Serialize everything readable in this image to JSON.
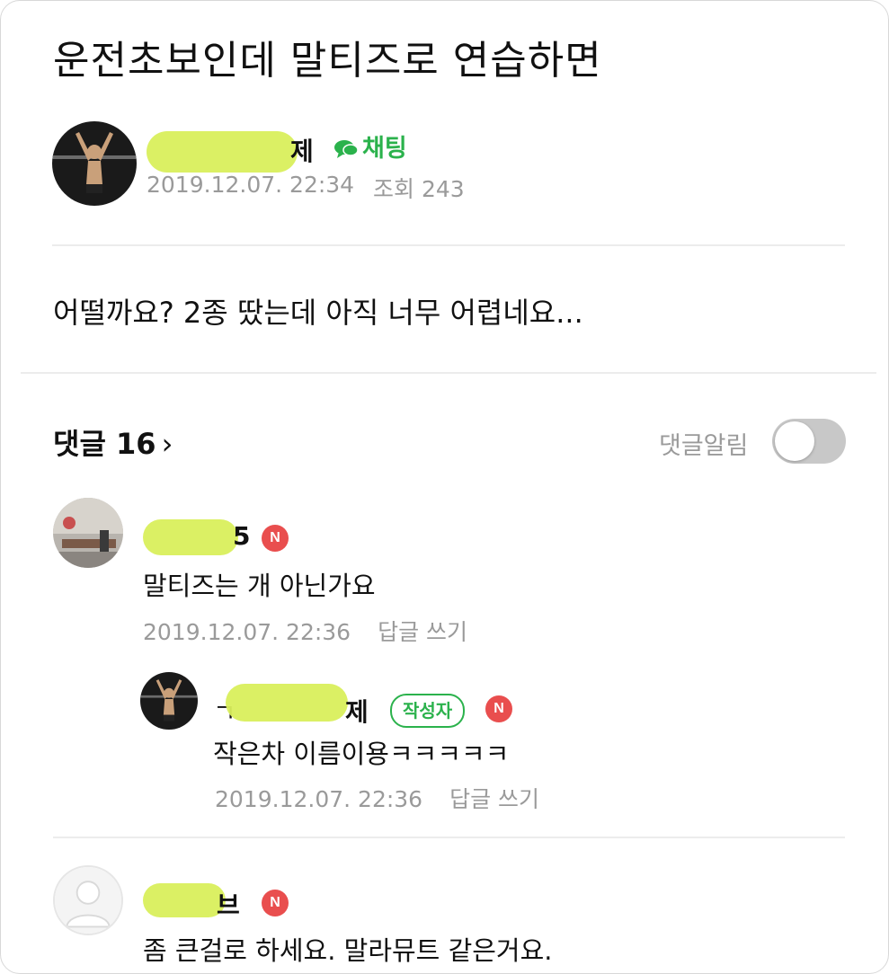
{
  "post": {
    "title": "운전초보인데 말티즈로 연습하면",
    "author_visible_suffix": "제",
    "chat_label": "채팅",
    "date": "2019.12.07. 22:34",
    "views": "조회 243",
    "body": "어떨까요? 2종 땄는데 아직 너무 어렵네요..."
  },
  "comments_header": {
    "label": "댓글 16",
    "chevron": "›",
    "alarm_label": "댓글알림",
    "alarm_on": false
  },
  "comments": [
    {
      "name_visible_suffix": "5",
      "badge": "N",
      "text": "말티즈는 개 아닌가요",
      "date": "2019.12.07. 22:36",
      "reply_label": "답글 쓰기"
    },
    {
      "is_reply": true,
      "name_visible_prefix": "ㄱ",
      "name_visible_suffix": "제",
      "author_badge": "작성자",
      "badge": "N",
      "text": "작은차 이름이용ㅋㅋㅋㅋㅋ",
      "date": "2019.12.07. 22:36",
      "reply_label": "답글 쓰기"
    },
    {
      "name_visible_suffix": "브",
      "badge": "N",
      "text": "좀 큰걸로 하세요. 말라뮤트 같은거요."
    }
  ],
  "colors": {
    "accent_green": "#2bb24c",
    "badge_red": "#e94e4e",
    "redaction_highlight": "#d9ef5c",
    "meta_gray": "#9a9a9a"
  },
  "icons": [
    "chat-bubble-icon",
    "chevron-right-icon",
    "toggle-switch",
    "default-avatar-icon"
  ]
}
